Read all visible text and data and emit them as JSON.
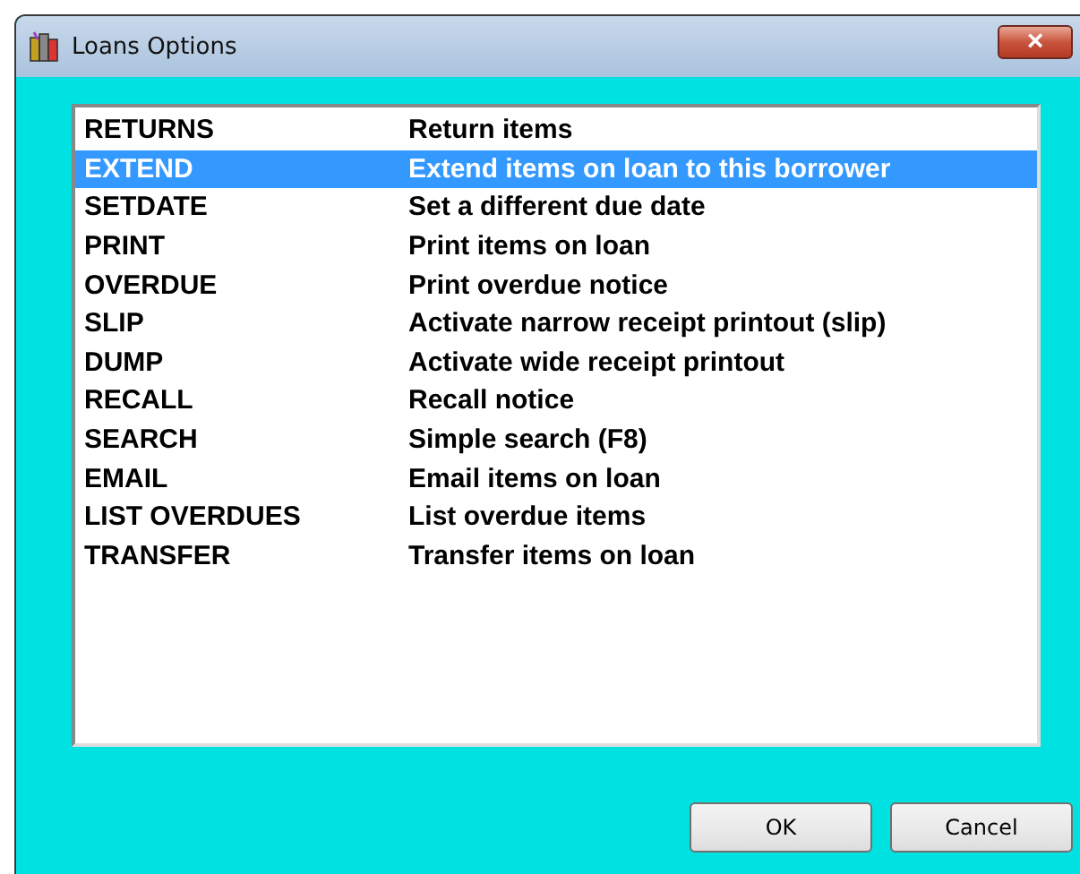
{
  "window": {
    "title": "Loans Options",
    "close": "×"
  },
  "options": [
    {
      "command": "RETURNS",
      "description": "Return items",
      "selected": false
    },
    {
      "command": "EXTEND",
      "description": "Extend items on loan to this borrower",
      "selected": true
    },
    {
      "command": "SETDATE",
      "description": "Set a different due date",
      "selected": false
    },
    {
      "command": "PRINT",
      "description": "Print items on loan",
      "selected": false
    },
    {
      "command": "OVERDUE",
      "description": "Print overdue notice",
      "selected": false
    },
    {
      "command": "SLIP",
      "description": "Activate narrow receipt printout (slip)",
      "selected": false
    },
    {
      "command": "DUMP",
      "description": "Activate wide receipt printout",
      "selected": false
    },
    {
      "command": "RECALL",
      "description": "Recall notice",
      "selected": false
    },
    {
      "command": "SEARCH",
      "description": "Simple search (F8)",
      "selected": false
    },
    {
      "command": "EMAIL",
      "description": "Email items on loan",
      "selected": false
    },
    {
      "command": "LIST OVERDUES",
      "description": "List overdue items",
      "selected": false
    },
    {
      "command": "TRANSFER",
      "description": "Transfer items on loan",
      "selected": false
    }
  ],
  "buttons": [
    "OK",
    "Cancel"
  ]
}
